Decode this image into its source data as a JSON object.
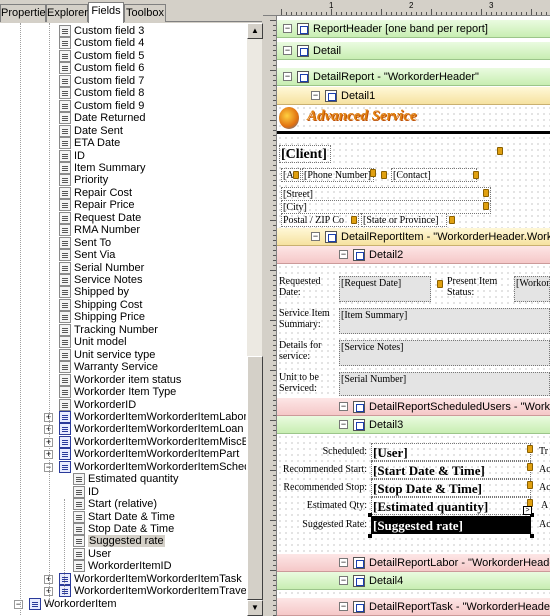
{
  "tabs": [
    {
      "label": "Properties"
    },
    {
      "label": "Explorer"
    },
    {
      "label": "Fields"
    },
    {
      "label": "Toolbox"
    }
  ],
  "tree": {
    "custom_items": [
      {
        "label": "Custom field 3"
      },
      {
        "label": "Custom field 4"
      },
      {
        "label": "Custom field 5"
      },
      {
        "label": "Custom field 6"
      },
      {
        "label": "Custom field 7"
      },
      {
        "label": "Custom field 8"
      },
      {
        "label": "Custom field 9"
      },
      {
        "label": "Date Returned"
      },
      {
        "label": "Date Sent"
      },
      {
        "label": "ETA Date"
      },
      {
        "label": "ID"
      },
      {
        "label": "Item Summary"
      },
      {
        "label": "Priority"
      },
      {
        "label": "Repair Cost"
      },
      {
        "label": "Repair Price"
      },
      {
        "label": "Request Date"
      },
      {
        "label": "RMA Number"
      },
      {
        "label": "Sent To"
      },
      {
        "label": "Sent Via"
      },
      {
        "label": "Serial Number"
      },
      {
        "label": "Service Notes"
      },
      {
        "label": "Shipped by"
      },
      {
        "label": "Shipping Cost"
      },
      {
        "label": "Shipping Price"
      },
      {
        "label": "Tracking Number"
      },
      {
        "label": "Unit model"
      },
      {
        "label": "Unit service type"
      },
      {
        "label": "Warranty Service"
      },
      {
        "label": "Workorder item status"
      },
      {
        "label": "Workorder Item Type"
      },
      {
        "label": "WorkorderID"
      }
    ],
    "child_tables": [
      {
        "label": "WorkorderItemWorkorderItemLabor",
        "expander": "+"
      },
      {
        "label": "WorkorderItemWorkorderItemLoan",
        "expander": "+"
      },
      {
        "label": "WorkorderItemWorkorderItemMiscExpense",
        "expander": "+"
      },
      {
        "label": "WorkorderItemWorkorderItemPart",
        "expander": "+"
      },
      {
        "label": "WorkorderItemWorkorderItemScheduledUser",
        "expander": "−"
      }
    ],
    "scheduled_user_fields": [
      {
        "label": "Estimated quantity"
      },
      {
        "label": "ID"
      },
      {
        "label": "Start (relative)"
      },
      {
        "label": "Start Date & Time"
      },
      {
        "label": "Stop Date & Time"
      },
      {
        "label": "Suggested rate"
      },
      {
        "label": "User"
      },
      {
        "label": "WorkorderItemID"
      }
    ],
    "after_tables": [
      {
        "label": "WorkorderItemWorkorderItemTask",
        "expander": "+"
      },
      {
        "label": "WorkorderItemWorkorderItemTravel",
        "expander": "+"
      }
    ],
    "root_item": {
      "label": "WorkorderItem",
      "expander": "−"
    },
    "selected": "Suggested rate"
  },
  "designer": {
    "ruler_marks": [
      "1",
      "2",
      "3"
    ],
    "bands": {
      "report_header": "ReportHeader [one band per report]",
      "detail": "Detail",
      "detail_report": "DetailReport - \"WorkorderHeader\"",
      "detail1": "Detail1",
      "detail_report_item": "DetailReportItem - \"WorkorderHeader.WorkorderItems\"",
      "detail2": "Detail2",
      "detail_report_sched": "DetailReportScheduledUsers - \"WorkorderHeader.WorkorderItems.WorkorderItemScheduledUser\"",
      "detail3": "Detail3",
      "detail_report_labor": "DetailReportLabor - \"WorkorderHeader.WorkorderItems.WorkorderItemLabor\"",
      "detail4": "Detail4",
      "detail_report_task": "DetailReportTask - \"WorkorderHeader.WorkorderItems.WorkorderItemTask\""
    },
    "logo_text": "Advanced Service",
    "client_fields": {
      "client": "[Client]",
      "phone": "[Phone Number]",
      "phone_prefix": "[A",
      "contact": "[Contact]",
      "street": "[Street]",
      "city": "[City]",
      "postal": "Postal / ZIP Co",
      "state": "[State or Province]"
    },
    "item_fields": {
      "requested_label": "Requested Date:",
      "request_date": "[Request Date]",
      "present_label": "Present Item Status:",
      "present_value": "[Workorder",
      "summary_label": "Service Item Summary:",
      "summary_value": "[Item Summary]",
      "details_label": "Details for service:",
      "details_value": "[Service Notes]",
      "unit_label": "Unit to be Serviced:",
      "unit_value": "[Serial Number]"
    },
    "sched_fields": {
      "scheduled_label": "Scheduled:",
      "user": "[User]",
      "rec_start_label": "Recommended Start:",
      "start": "[Start Date & Time]",
      "rec_stop_label": "Recommended Stop:",
      "stop": "[Stop Date & Time]",
      "est_qty_label": "Estimated Qty:",
      "est_qty": "[Estimated quantity]",
      "sugg_rate_label": "Suggested Rate:",
      "sugg_rate": "[Suggested rate]",
      "trunc": [
        "Tr",
        "Ac",
        "Ac",
        "A",
        "Ac"
      ]
    }
  }
}
